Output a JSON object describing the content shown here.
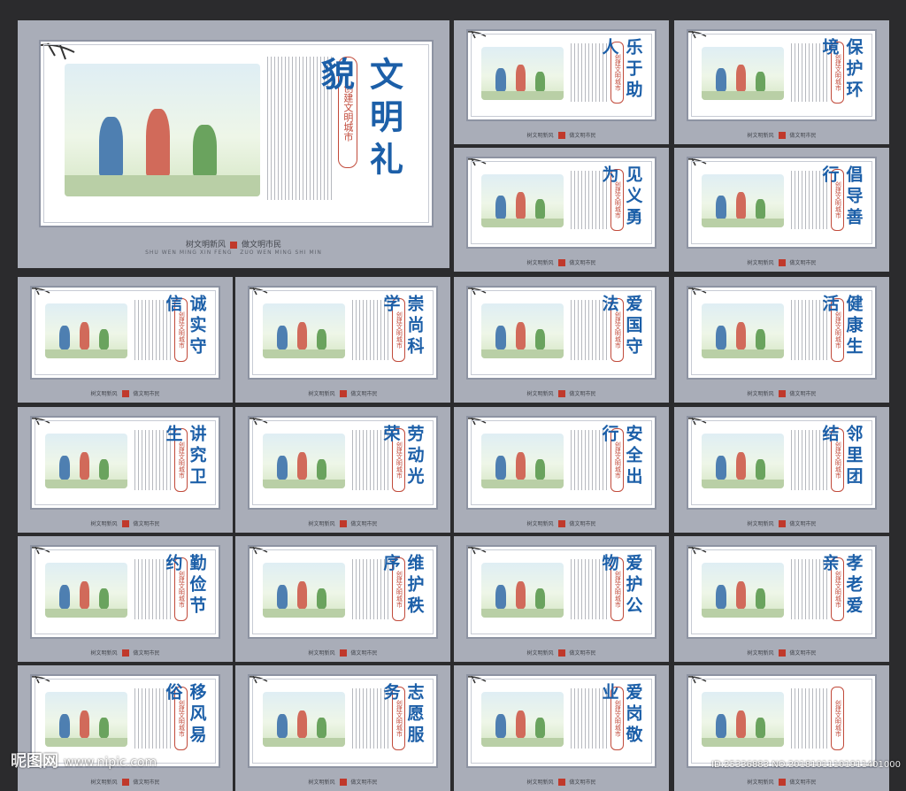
{
  "seal_text": "创建文明城市",
  "footer": {
    "left": "树文明新风",
    "right": "做文明市民",
    "left_pinyin": "SHU WEN MING XIN FENG",
    "right_pinyin": "ZUO WEN MING SHI MIN",
    "stamp": "文明公约"
  },
  "main": {
    "title": "文明礼貌"
  },
  "boards": [
    {
      "title": "文明礼貌"
    },
    {
      "title": "乐于助人"
    },
    {
      "title": "保护环境"
    },
    {
      "title": "见义勇为"
    },
    {
      "title": "倡导善行"
    },
    {
      "title": "诚实守信"
    },
    {
      "title": "崇尚科学"
    },
    {
      "title": "爱国守法"
    },
    {
      "title": "健康生活"
    },
    {
      "title": "讲究卫生"
    },
    {
      "title": "劳动光荣"
    },
    {
      "title": "安全出行"
    },
    {
      "title": "邻里团结"
    },
    {
      "title": "勤俭节约"
    },
    {
      "title": "维护秩序"
    },
    {
      "title": "爱护公物"
    },
    {
      "title": "孝老爱亲"
    },
    {
      "title": "移风易俗"
    },
    {
      "title": "志愿服务"
    },
    {
      "title": "爱岗敬业"
    }
  ],
  "watermark": {
    "brand": "昵图网",
    "url": "www.nipic.com"
  },
  "id_text": "ID:25336883 NO:20181011101911401000",
  "colors": {
    "title": "#1c5fa8",
    "seal": "#c14a3a",
    "panel": "#a9adb8",
    "background": "#2b2b2d"
  }
}
